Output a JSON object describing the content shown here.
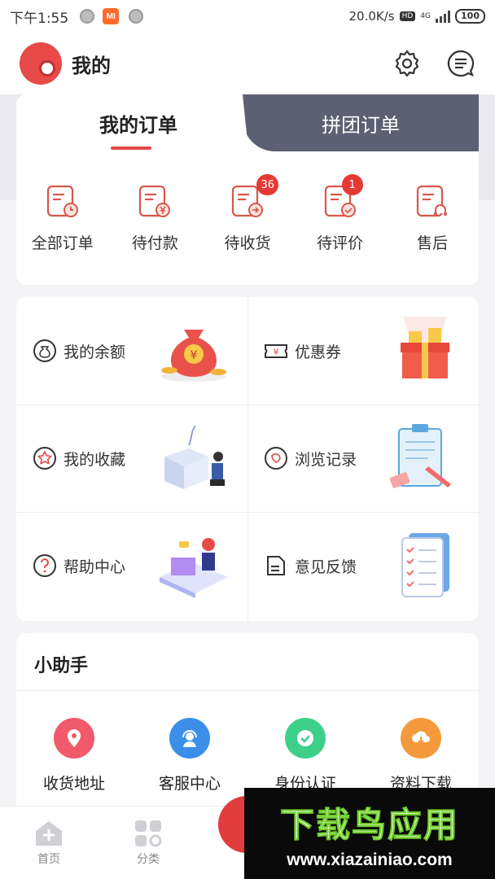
{
  "status": {
    "time": "下午1:55",
    "mi_label": "MI",
    "speed": "20.0K/s",
    "hd": "HD",
    "net": "4G",
    "battery": "100"
  },
  "header": {
    "title": "我的",
    "icons": [
      "gear-icon",
      "message-icon"
    ]
  },
  "orders": {
    "tab_active": "我的订单",
    "tab_inactive": "拼团订单",
    "items": [
      {
        "label": "全部订单",
        "icon": "clock-order-icon",
        "badge": ""
      },
      {
        "label": "待付款",
        "icon": "yen-order-icon",
        "badge": ""
      },
      {
        "label": "待收货",
        "icon": "arrow-order-icon",
        "badge": "36"
      },
      {
        "label": "待评价",
        "icon": "check-order-icon",
        "badge": "1"
      },
      {
        "label": "售后",
        "icon": "headset-order-icon",
        "badge": ""
      }
    ]
  },
  "grid": [
    {
      "label": "我的余额",
      "icon": "money-bag-icon"
    },
    {
      "label": "优惠券",
      "icon": "coupon-icon"
    },
    {
      "label": "我的收藏",
      "icon": "star-icon"
    },
    {
      "label": "浏览记录",
      "icon": "history-icon"
    },
    {
      "label": "帮助中心",
      "icon": "question-icon"
    },
    {
      "label": "意见反馈",
      "icon": "feedback-icon"
    }
  ],
  "helper": {
    "title": "小助手",
    "items": [
      {
        "label": "收货地址",
        "icon": "location-icon",
        "color": "#f05a6a"
      },
      {
        "label": "客服中心",
        "icon": "support-icon",
        "color": "#3b8fe8"
      },
      {
        "label": "身份认证",
        "icon": "verify-icon",
        "color": "#3ecf8a"
      },
      {
        "label": "资料下载",
        "icon": "download-icon",
        "color": "#f59a3c"
      }
    ]
  },
  "nav": {
    "home": "首页",
    "category": "分类"
  },
  "watermark": {
    "title": "下载鸟应用",
    "url": "www.xiazainiao.com"
  },
  "colors": {
    "accent": "#e04848",
    "tab_dark": "#5d5f72"
  }
}
